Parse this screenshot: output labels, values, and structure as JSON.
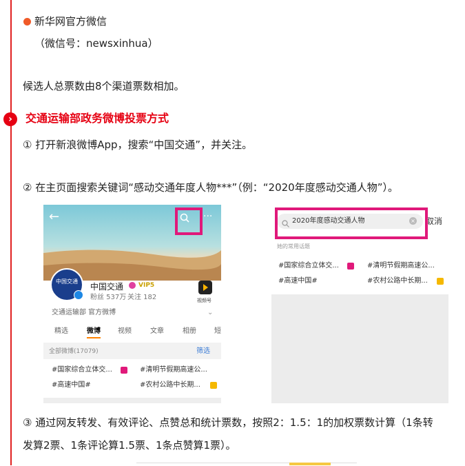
{
  "article": {
    "source_name": "新华网官方微信",
    "source_id": "（微信号：newsxinhua）",
    "total_rule": "候选人总票数由8个渠道票数相加。",
    "section_heading": "交通运输部政务微博投票方式",
    "step1": "① 打开新浪微博App，搜索“中国交通”，并关注。",
    "step2": "② 在主页面搜索关键词“感动交通年度人物***”（例：“2020年度感动交通人物”）。",
    "step3_line1": "③ 通过网友转发、有效评论、点赞总和统计票数，按照2：1.5：1的加权票数计算（1条转",
    "step3_line2": "发算2票、1条评论算1.5票、1条点赞算1票）。"
  },
  "profile_screenshot": {
    "account_name": "中国交通",
    "vip_badge": "VIP5",
    "followers": "粉丝 537万",
    "following": "关注 182",
    "verified": "交通运输部 官方微博",
    "video_badge": "视频号",
    "tabs": [
      "精选",
      "微博",
      "视频",
      "文章",
      "相册",
      "短"
    ],
    "all_weibo": "全部微博(17079)",
    "filter": "筛选",
    "topics": [
      "#国家综合立体交...",
      "#清明节假期高速公...",
      "#高速中国#",
      "#农村公路中长期..."
    ],
    "logo_text": "中国交通"
  },
  "search_screenshot": {
    "query": "2020年度感动交通人物",
    "cancel": "取消",
    "common_topics": "她的常用话题",
    "topics": [
      "#国家综合立体交...",
      "#清明节假期高速公...",
      "#高速中国#",
      "#农村公路中长期..."
    ]
  },
  "colors": {
    "accent_red": "#e60012",
    "highlight_pink": "#e0197a",
    "weibo_orange": "#ff8200"
  }
}
